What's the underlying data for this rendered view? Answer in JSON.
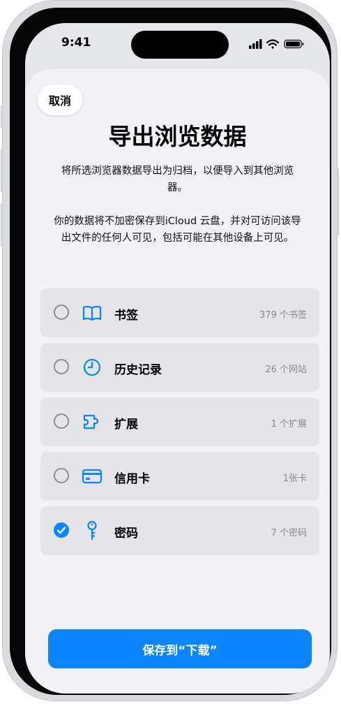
{
  "status_bar": {
    "time": "9:41"
  },
  "sheet": {
    "cancel_label": "取消",
    "title": "导出浏览数据",
    "description_1": "将所选浏览器数据导出为归档，以便导入到其他浏览器。",
    "description_2": "你的数据将不加密保存到iCloud 云盘，并对可访问该导出文件的任何人可见，包括可能在其他设备上可见。",
    "items": [
      {
        "label": "书签",
        "count": "379 个书签",
        "icon": "book-icon",
        "checked": false
      },
      {
        "label": "历史记录",
        "count": "26 个网站",
        "icon": "clock-icon",
        "checked": false
      },
      {
        "label": "扩展",
        "count": "1 个扩展",
        "icon": "puzzle-icon",
        "checked": false
      },
      {
        "label": "信用卡",
        "count": "1张卡",
        "icon": "credit-card-icon",
        "checked": false
      },
      {
        "label": "密码",
        "count": "7 个密码",
        "icon": "key-icon",
        "checked": true
      }
    ],
    "save_label": "保存到“下载”"
  },
  "colors": {
    "accent": "#0a84ff",
    "row_bg": "#e4e4e9",
    "sheet_bg": "#f2f2f6"
  }
}
